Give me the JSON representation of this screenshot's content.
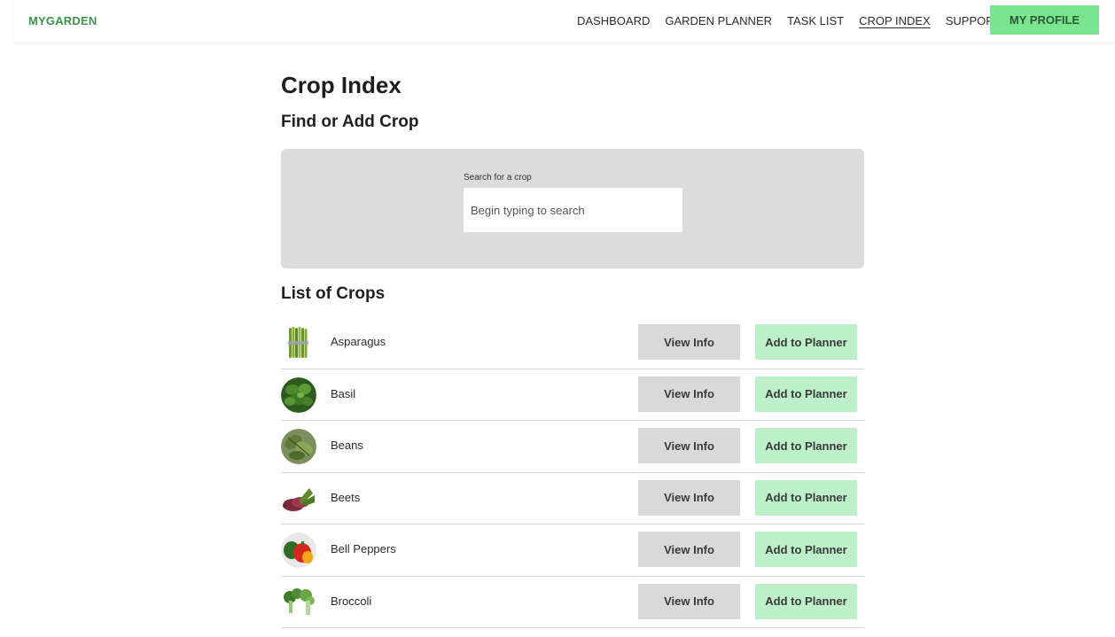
{
  "nav": {
    "brand": "MYGARDEN",
    "links": [
      "DASHBOARD",
      "GARDEN PLANNER",
      "TASK LIST",
      "CROP INDEX",
      "SUPPORT"
    ],
    "active": "CROP INDEX",
    "profile_label": "MY PROFILE"
  },
  "colors": {
    "brand": "#3f8f4d",
    "profile_button": "#7ae58f",
    "add_button": "#bdf0c8",
    "info_button": "#d9d9d9",
    "search_panel": "#dcdcdc"
  },
  "main": {
    "title": "Crop Index",
    "find_title": "Find or Add Crop",
    "search": {
      "label": "Search for a crop",
      "placeholder": "Begin typing to search",
      "value": ""
    },
    "list_title": "List of Crops"
  },
  "crops": [
    {
      "name": "Asparagus",
      "icon": "asparagus-icon",
      "view_label": "View Info",
      "add_label": "Add to Planner"
    },
    {
      "name": "Basil",
      "icon": "basil-icon",
      "view_label": "View Info",
      "add_label": "Add to Planner"
    },
    {
      "name": "Beans",
      "icon": "beans-icon",
      "view_label": "View Info",
      "add_label": "Add to Planner"
    },
    {
      "name": "Beets",
      "icon": "beets-icon",
      "view_label": "View Info",
      "add_label": "Add to Planner"
    },
    {
      "name": "Bell Peppers",
      "icon": "bell-peppers-icon",
      "view_label": "View Info",
      "add_label": "Add to Planner"
    },
    {
      "name": "Broccoli",
      "icon": "broccoli-icon",
      "view_label": "View Info",
      "add_label": "Add to Planner"
    }
  ]
}
